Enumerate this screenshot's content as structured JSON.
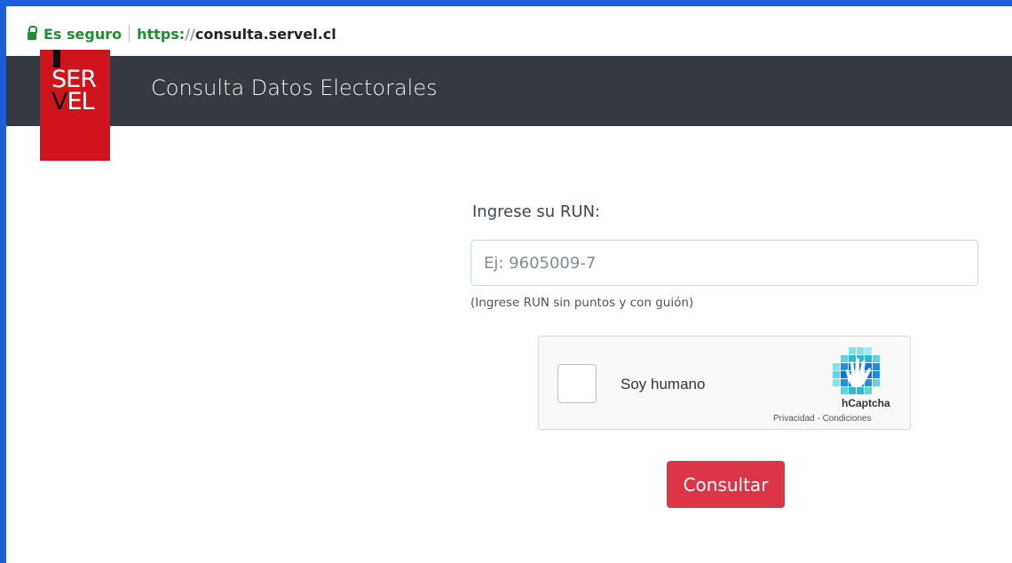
{
  "browser": {
    "secure_label": "Es seguro",
    "url_scheme": "https:",
    "url_slashes": "//",
    "url_host": "consulta.servel.cl"
  },
  "header": {
    "logo_line1": "SER",
    "logo_line2_v": "V",
    "logo_line2_rest": "EL",
    "title": "Consulta Datos Electorales"
  },
  "form": {
    "run_label": "Ingrese su RUN:",
    "run_placeholder": "Ej: 9605009-7",
    "run_value": "",
    "run_hint": "(Ingrese RUN sin puntos y con guión)",
    "captcha_label": "Soy humano",
    "captcha_brand": "hCaptcha",
    "captcha_links": "Privacidad - Condiciones",
    "submit_label": "Consultar"
  },
  "colors": {
    "accent_blue_border": "#1b5ed6",
    "header_bg": "#343a40",
    "logo_red": "#d0141b",
    "button_red": "#dc3545",
    "secure_green": "#1f8f2f"
  }
}
